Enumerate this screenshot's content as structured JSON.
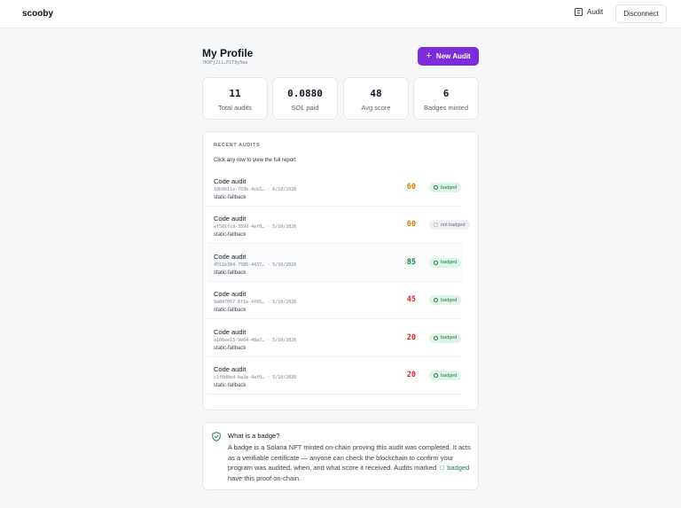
{
  "app": {
    "brand": "scooby",
    "nav_audit": "Audit",
    "disconnect": "Disconnect"
  },
  "profile": {
    "title": "My Profile",
    "wallet": "7K8Fj2ii…P1T3y5ma",
    "new_audit": "New Audit"
  },
  "stats": [
    {
      "value": "11",
      "label": "Total audits"
    },
    {
      "value": "0.0880",
      "label": "SOL paid"
    },
    {
      "value": "48",
      "label": "Avg score"
    },
    {
      "value": "6",
      "label": "Badges minted"
    }
  ],
  "recent": {
    "heading": "RECENT AUDITS",
    "subtitle": "Click any row to view the full report",
    "rows": [
      {
        "name": "Code audit",
        "meta": "10b9611e-703b-4cb3… · 6/10/2026",
        "source": "static-fallback",
        "score": "60",
        "score_color": "#d97706",
        "badge": "badged",
        "badged": true
      },
      {
        "name": "Code audit",
        "meta": "ef501fc3-359d-4ef0… · 5/10/2026",
        "source": "static-fallback",
        "score": "60",
        "score_color": "#d97706",
        "badge": "not badged",
        "badged": false
      },
      {
        "name": "Code audit",
        "meta": "4551b384-7586-4437… · 5/10/2026",
        "source": "static-fallback",
        "score": "85",
        "score_color": "#15803d",
        "badge": "badged",
        "badged": true
      },
      {
        "name": "Code audit",
        "meta": "9a847057-6f1e-4f65… · 5/10/2026",
        "source": "static-fallback",
        "score": "45",
        "score_color": "#dc2626",
        "badge": "badged",
        "badged": true
      },
      {
        "name": "Code audit",
        "meta": "a166ee15-9e64-48a7… · 5/10/2026",
        "source": "static-fallback",
        "score": "20",
        "score_color": "#dc2626",
        "badge": "badged",
        "badged": true
      },
      {
        "name": "Code audit",
        "meta": "c1f0d0ed-ba3e-4af0… · 5/10/2026",
        "source": "static-fallback",
        "score": "20",
        "score_color": "#dc2626",
        "badge": "badged",
        "badged": true
      }
    ]
  },
  "info": {
    "question": "What is a badge?",
    "body_start": "A badge is a Solana NFT minted on-chain proving this audit was completed. It acts as a verifiable certificate — anyone can check the blockchain to confirm your program was audited, when, and what score it received. Audits marked",
    "pill": "badged",
    "body_end": "have this proof on-chain."
  },
  "colors": {
    "accent": "#7c2cd9",
    "badge_bg": "#dcf5e7",
    "badge_text": "#237a48"
  }
}
